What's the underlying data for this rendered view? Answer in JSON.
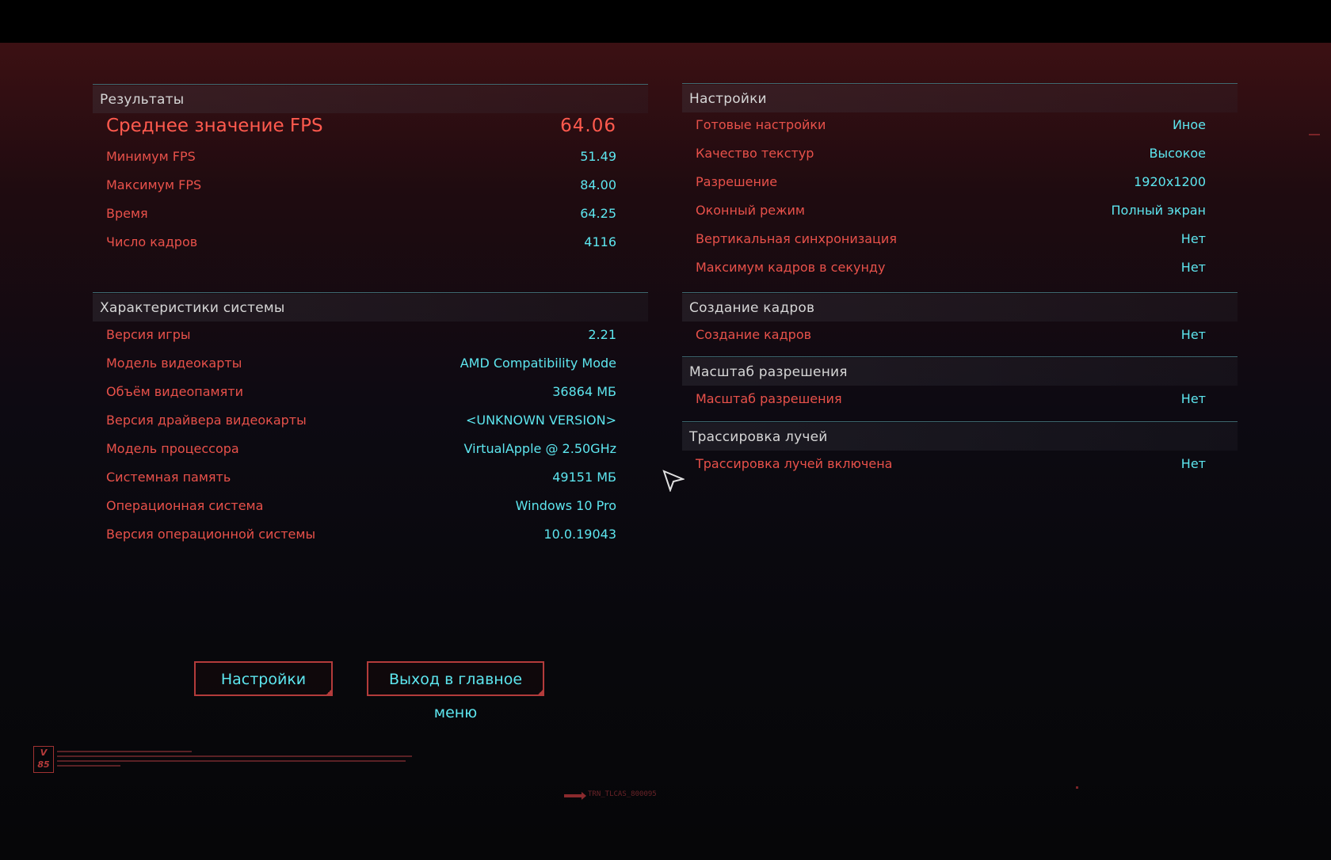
{
  "results": {
    "title": "Результаты",
    "avg_fps": {
      "label": "Среднее значение FPS",
      "value": "64.06"
    },
    "rows": [
      {
        "label": "Минимум FPS",
        "value": "51.49"
      },
      {
        "label": "Максимум FPS",
        "value": "84.00"
      },
      {
        "label": "Время",
        "value": "64.25"
      },
      {
        "label": "Число кадров",
        "value": "4116"
      }
    ]
  },
  "system": {
    "title": "Характеристики системы",
    "rows": [
      {
        "label": "Версия игры",
        "value": "2.21"
      },
      {
        "label": "Модель видеокарты",
        "value": "AMD Compatibility Mode"
      },
      {
        "label": "Объём видеопамяти",
        "value": "36864 МБ"
      },
      {
        "label": "Версия драйвера видеокарты",
        "value": "<UNKNOWN VERSION>"
      },
      {
        "label": "Модель процессора",
        "value": "VirtualApple @ 2.50GHz"
      },
      {
        "label": "Системная память",
        "value": "49151 МБ"
      },
      {
        "label": "Операционная система",
        "value": "Windows 10 Pro"
      },
      {
        "label": "Версия операционной системы",
        "value": "10.0.19043"
      }
    ]
  },
  "settings": {
    "title": "Настройки",
    "rows": [
      {
        "label": "Готовые настройки",
        "value": "Иное"
      },
      {
        "label": "Качество текстур",
        "value": "Высокое"
      },
      {
        "label": "Разрешение",
        "value": "1920x1200"
      },
      {
        "label": "Оконный режим",
        "value": "Полный экран"
      },
      {
        "label": "Вертикальная синхронизация",
        "value": "Нет"
      },
      {
        "label": "Максимум кадров в секунду",
        "value": "Нет"
      }
    ]
  },
  "frame_gen": {
    "title": "Создание кадров",
    "rows": [
      {
        "label": "Создание кадров",
        "value": "Нет"
      }
    ]
  },
  "resolution_scaling": {
    "title": "Масштаб разрешения",
    "rows": [
      {
        "label": "Масштаб разрешения",
        "value": "Нет"
      }
    ]
  },
  "ray_tracing": {
    "title": "Трассировка лучей",
    "rows": [
      {
        "label": "Трассировка лучей включена",
        "value": "Нет"
      }
    ]
  },
  "buttons": {
    "settings": "Настройки",
    "exit": "Выход в главное меню"
  },
  "footer": {
    "logo": "V\n85",
    "build": "TRN_TLCAS_800095"
  },
  "colors": {
    "label_red": "#e8514a",
    "value_cyan": "#5de6ef",
    "header_text": "#d6d6d6",
    "accent_line": "#3f6b72",
    "button_border": "#b33b3b"
  }
}
